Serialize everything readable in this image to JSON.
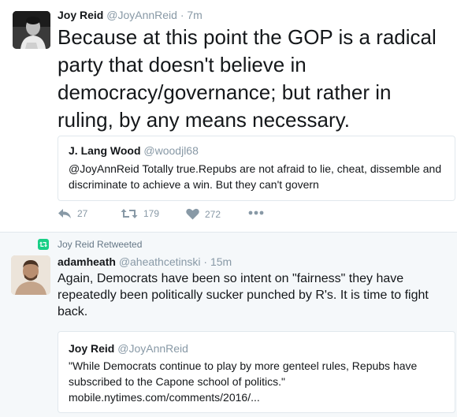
{
  "tweet1": {
    "author_name": "Joy Reid",
    "author_handle": "@JoyAnnReid",
    "time": "· 7m",
    "text": "Because at this point the GOP is a radical party that doesn't believe in democracy/governance; but rather in ruling, by any means necessary.",
    "quoted": {
      "author_name": "J. Lang Wood",
      "author_handle": "@woodjl68",
      "text": "@JoyAnnReid Totally true.Repubs are not afraid to lie, cheat, dissemble and discriminate to achieve a win. But they can't govern"
    },
    "actions": {
      "reply_count": "27",
      "retweet_count": "179",
      "like_count": "272",
      "more_icon": "more-dots-icon"
    }
  },
  "tweet2": {
    "retweeted_by": "Joy Reid Retweeted",
    "author_name": "adamheath",
    "author_handle": "@aheathcetinski",
    "time": "· 15m",
    "text": "Again, Democrats have been so intent on \"fairness\" they have repeatedly been  politically sucker punched by R's. It is time to fight back.",
    "quoted": {
      "author_name": "Joy Reid",
      "author_handle": "@JoyAnnReid",
      "text": "\"While Democrats continue to play by more genteel rules, Repubs have subscribed to the Capone school of politics.\" mobile.nytimes.com/comments/2016/..."
    }
  },
  "colors": {
    "retweet_green": "#19cf86",
    "secondary_text": "#8899a6",
    "border": "#e1e8ed"
  }
}
